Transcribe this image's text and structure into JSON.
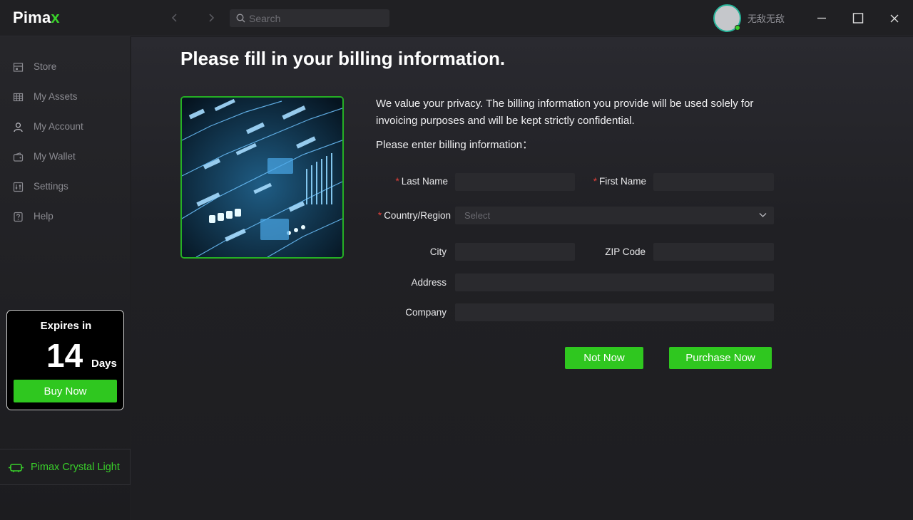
{
  "app": {
    "logo_main": "Pima",
    "logo_accent": "x",
    "search_placeholder": "Search",
    "username": "无敌无敌"
  },
  "sidebar": {
    "items": [
      {
        "label": "Store",
        "icon": "store-icon"
      },
      {
        "label": "My Assets",
        "icon": "grid-icon"
      },
      {
        "label": "My Account",
        "icon": "user-icon"
      },
      {
        "label": "My Wallet",
        "icon": "wallet-icon"
      },
      {
        "label": "Settings",
        "icon": "sliders-icon"
      },
      {
        "label": "Help",
        "icon": "help-icon"
      }
    ],
    "expire": {
      "title": "Expires in",
      "number": "14",
      "unit": "Days",
      "buy_label": "Buy Now"
    },
    "device": {
      "label": "Pimax Crystal Light",
      "icon": "vr-headset-icon"
    }
  },
  "billing": {
    "title": "Please fill in your billing information.",
    "privacy_text": "We value your privacy. The billing information you provide will be used solely for invoicing purposes and will be kept strictly confidential.",
    "prompt": "Please enter billing information：",
    "fields": {
      "last_name": {
        "label": "Last Name",
        "required": "*",
        "value": ""
      },
      "first_name": {
        "label": "First Name",
        "required": "*",
        "value": ""
      },
      "country": {
        "label": "Country/Region",
        "required": "*",
        "placeholder": "Select"
      },
      "city": {
        "label": "City",
        "value": ""
      },
      "zip": {
        "label": "ZIP Code",
        "value": ""
      },
      "address": {
        "label": "Address",
        "value": ""
      },
      "company": {
        "label": "Company",
        "value": ""
      }
    },
    "buttons": {
      "not_now": "Not Now",
      "purchase": "Purchase Now"
    }
  },
  "colors": {
    "accent": "#2fc71f",
    "background": "#1d1d20",
    "required": "#e0403a"
  }
}
